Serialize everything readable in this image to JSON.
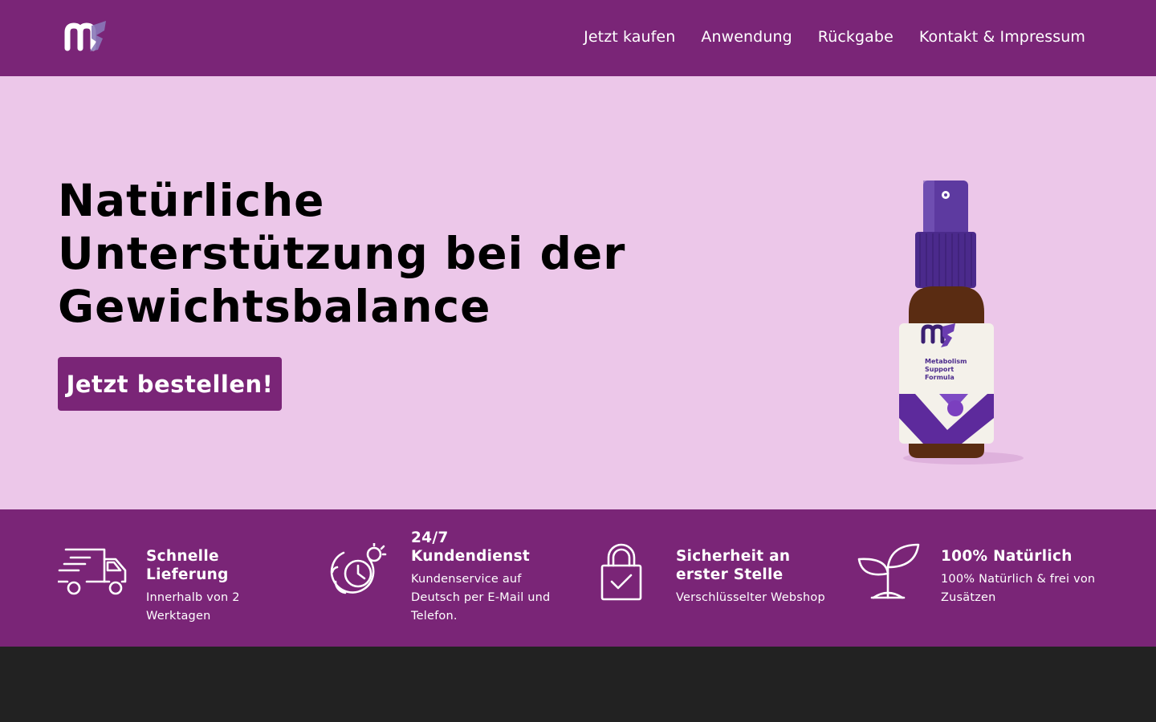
{
  "header": {
    "logo_alt": "ms",
    "nav": [
      {
        "label": "Jetzt kaufen"
      },
      {
        "label": "Anwendung"
      },
      {
        "label": "Rückgabe"
      },
      {
        "label": "Kontakt & Impressum"
      }
    ]
  },
  "hero": {
    "title": "Natürliche Unterstützung bei der Gewichtsbalance",
    "cta_label": "Jetzt bestellen!",
    "product": {
      "line1": "Metabolism",
      "line2": "Support",
      "line3": "Formula"
    }
  },
  "features": [
    {
      "icon": "delivery-truck-icon",
      "title": "Schnelle Lieferung",
      "desc": "Innerhalb von 2 Werktagen"
    },
    {
      "icon": "support-clock-icon",
      "title": "24/7 Kundendienst",
      "desc": "Kundenservice auf Deutsch per E-Mail und Telefon."
    },
    {
      "icon": "padlock-check-icon",
      "title": "Sicherheit an erster Stelle",
      "desc": "Verschlüsselter Webshop"
    },
    {
      "icon": "sprout-icon",
      "title": "100% Natürlich",
      "desc": "100% Natürlich & frei von Zusätzen"
    }
  ],
  "colors": {
    "brand_purple": "#7a2577",
    "hero_pink": "#ecc7e9",
    "footer_dark": "#222222"
  }
}
